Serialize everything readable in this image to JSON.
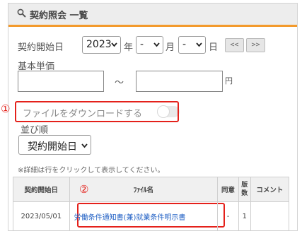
{
  "header": {
    "title": "契約照会 一覧"
  },
  "search": {
    "start_date_label": "契約開始日",
    "year_value": "2023",
    "year_unit": "年",
    "month_value": "-",
    "month_unit": "月",
    "day_value": "-",
    "day_unit": "日",
    "prev_label": "<<",
    "next_label": ">>",
    "base_price_label": "基本単価",
    "range_separator": "～",
    "currency_unit": "円",
    "download_toggle_label": "ファイルをダウンロードする",
    "download_toggle_on": false,
    "sort_label": "並び順",
    "sort_value": "契約開始日",
    "hint_text": "※詳細は行をクリックして表示してください。"
  },
  "annotations": {
    "marker_1": "①",
    "marker_2": "②"
  },
  "table": {
    "headers": [
      "契約開始日",
      "ﾌｧｲﾙ名",
      "同意",
      "版数",
      "コメント"
    ],
    "rows": [
      {
        "start_date": "2023/05/01",
        "file_name": "労働条件通知書(兼)就業条件明示書",
        "agreement": "-",
        "version": "1",
        "comment": ""
      }
    ]
  },
  "colors": {
    "accent_orange": "#f39a2c",
    "annotation_red": "#e4211b",
    "link_blue": "#1f5fc4"
  }
}
